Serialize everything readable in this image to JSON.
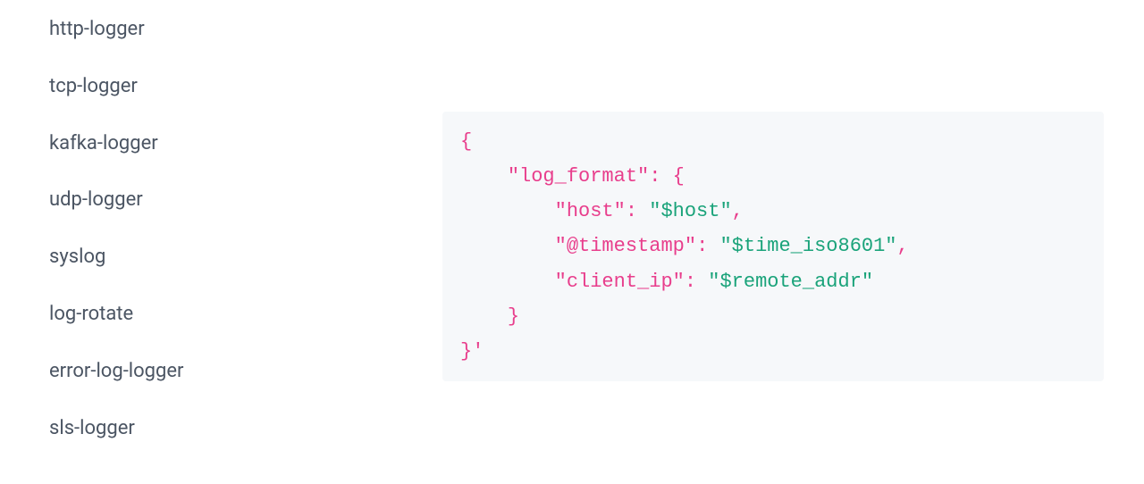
{
  "sidebar": {
    "items": [
      {
        "label": "http-logger"
      },
      {
        "label": "tcp-logger"
      },
      {
        "label": "kafka-logger"
      },
      {
        "label": "udp-logger"
      },
      {
        "label": "syslog"
      },
      {
        "label": "log-rotate"
      },
      {
        "label": "error-log-logger"
      },
      {
        "label": "sls-logger"
      }
    ]
  },
  "code": {
    "l1_open": "{",
    "l2_key": "\"log_format\"",
    "l2_colon": ":",
    "l2_open": "{",
    "l3_key": "\"host\"",
    "l3_colon": ":",
    "l3_val": "\"$host\"",
    "l3_comma": ",",
    "l4_key": "\"@timestamp\"",
    "l4_colon": ":",
    "l4_val": "\"$time_iso8601\"",
    "l4_comma": ",",
    "l5_key": "\"client_ip\"",
    "l5_colon": ":",
    "l5_val": "\"$remote_addr\"",
    "l6_close": "}",
    "l7_close": "}'"
  }
}
